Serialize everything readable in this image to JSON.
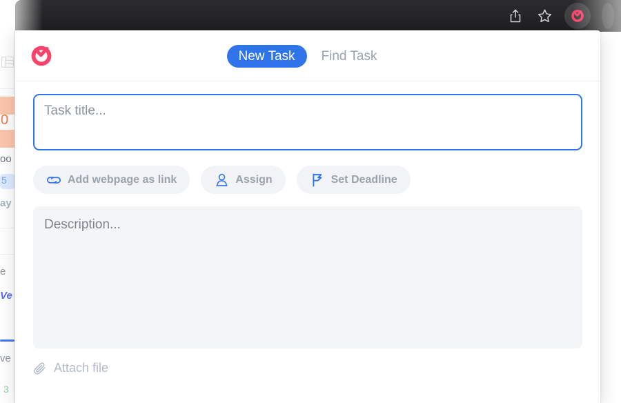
{
  "browser": {
    "share_icon": "share-icon",
    "bookmark_icon": "star-icon",
    "extension_icon": "app-logo-icon"
  },
  "page_behind": {
    "grid_icon": "grid-icon",
    "number_badge": "0",
    "text_fragment_1": "oo",
    "chip_number": "5",
    "text_fragment_2": "ay",
    "text_fragment_3": "e",
    "highlight_word": "Ve",
    "text_fragment_4": "ve",
    "green_number": "3"
  },
  "popup": {
    "logo_icon": "app-logo-icon",
    "tabs": [
      {
        "label": "New Task",
        "active": true
      },
      {
        "label": "Find Task",
        "active": false
      }
    ],
    "title_field": {
      "placeholder": "Task title...",
      "value": ""
    },
    "actions": [
      {
        "label": "Add webpage as link",
        "icon": "link-icon"
      },
      {
        "label": "Assign",
        "icon": "person-icon"
      },
      {
        "label": "Set Deadline",
        "icon": "flag-icon"
      }
    ],
    "description_field": {
      "placeholder": "Description...",
      "value": ""
    },
    "attach": {
      "label": "Attach file",
      "icon": "paperclip-icon"
    }
  },
  "colors": {
    "accent_blue": "#2f74e8",
    "brand_pink": "#f9436b",
    "muted_text": "#9aa2ab",
    "chip_bg": "#f1f3f6",
    "description_bg": "#f4f5f7"
  }
}
